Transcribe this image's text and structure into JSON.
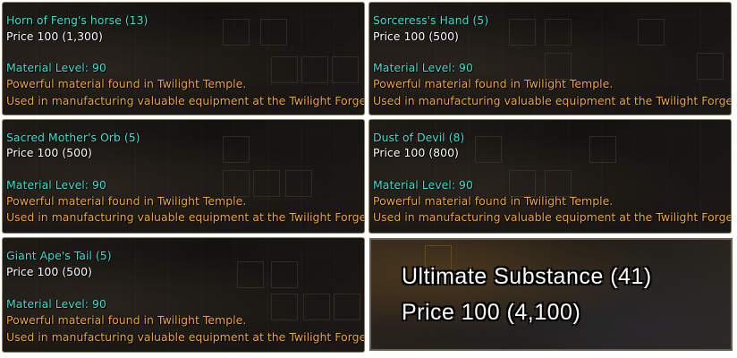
{
  "tooltips": [
    {
      "name": "Horn of Feng's horse (13)",
      "price": "Price 100 (1,300)",
      "material_level": "Material Level: 90",
      "desc1": "Powerful material found in Twilight Temple.",
      "desc2": "Used in manufacturing valuable equipment at the Twilight Forges."
    },
    {
      "name": "Sorceress's Hand (5)",
      "price": "Price 100 (500)",
      "material_level": "Material Level: 90",
      "desc1": "Powerful material found in Twilight Temple.",
      "desc2": "Used in manufacturing valuable equipment at the Twilight Forges."
    },
    {
      "name": "Sacred Mother's Orb (5)",
      "price": "Price 100 (500)",
      "material_level": "Material Level: 90",
      "desc1": "Powerful material found in Twilight Temple.",
      "desc2": "Used in manufacturing valuable equipment at the Twilight Forges."
    },
    {
      "name": "Dust of Devil (8)",
      "price": "Price 100 (800)",
      "material_level": "Material Level: 90",
      "desc1": "Powerful material found in Twilight Temple.",
      "desc2": "Used in manufacturing valuable equipment at the Twilight Forges."
    },
    {
      "name": "Giant Ape's Tail (5)",
      "price": "Price 100 (500)",
      "material_level": "Material Level: 90",
      "desc1": "Powerful material found in Twilight Temple.",
      "desc2": "Used in manufacturing valuable equipment at the Twilight Forges."
    }
  ],
  "large_tooltip": {
    "name": "Ultimate Substance (41)",
    "price": "Price 100 (4,100)"
  },
  "colors": {
    "name": "#3fe0d0",
    "price": "#ffffff",
    "material_level": "#3fe0d0",
    "description": "#f0a830"
  }
}
